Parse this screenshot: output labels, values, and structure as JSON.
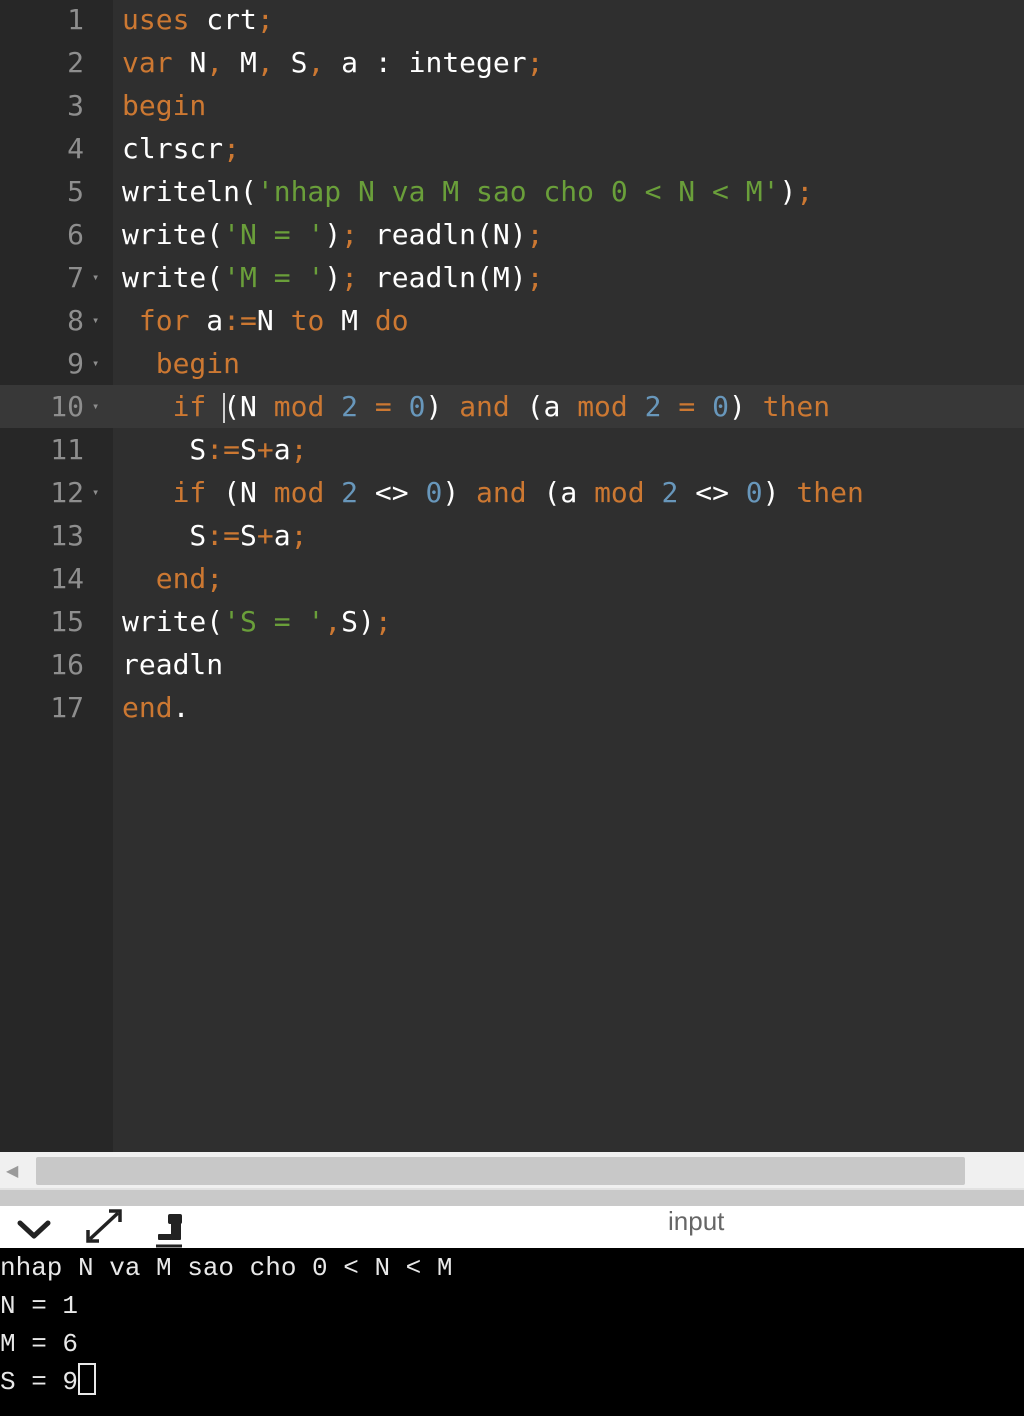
{
  "editor": {
    "lines": [
      {
        "num": "1",
        "fold": "",
        "tokens": [
          [
            "k",
            "uses "
          ],
          [
            "t",
            "crt"
          ],
          [
            "k",
            ";"
          ]
        ]
      },
      {
        "num": "2",
        "fold": "",
        "tokens": [
          [
            "k",
            "var "
          ],
          [
            "t",
            "N"
          ],
          [
            "k",
            ", "
          ],
          [
            "t",
            "M"
          ],
          [
            "k",
            ", "
          ],
          [
            "t",
            "S"
          ],
          [
            "k",
            ", "
          ],
          [
            "t",
            "a : integer"
          ],
          [
            "k",
            ";"
          ]
        ]
      },
      {
        "num": "3",
        "fold": "",
        "tokens": [
          [
            "k",
            "begin"
          ]
        ]
      },
      {
        "num": "4",
        "fold": "",
        "tokens": [
          [
            "t",
            "clrscr"
          ],
          [
            "k",
            ";"
          ]
        ]
      },
      {
        "num": "5",
        "fold": "",
        "tokens": [
          [
            "t",
            "writeln("
          ],
          [
            "s",
            "'nhap N va M sao cho 0 < N < M'"
          ],
          [
            "t",
            ")"
          ],
          [
            "k",
            ";"
          ]
        ]
      },
      {
        "num": "6",
        "fold": "",
        "tokens": [
          [
            "t",
            "write("
          ],
          [
            "s",
            "'N = '"
          ],
          [
            "t",
            ")"
          ],
          [
            "k",
            "; "
          ],
          [
            "t",
            "readln(N)"
          ],
          [
            "k",
            ";"
          ]
        ]
      },
      {
        "num": "7",
        "fold": "▾",
        "tokens": [
          [
            "t",
            "write("
          ],
          [
            "s",
            "'M = '"
          ],
          [
            "t",
            ")"
          ],
          [
            "k",
            "; "
          ],
          [
            "t",
            "readln(M)"
          ],
          [
            "k",
            ";"
          ]
        ]
      },
      {
        "num": "8",
        "fold": "▾",
        "tokens": [
          [
            "t",
            " "
          ],
          [
            "k",
            "for "
          ],
          [
            "t",
            "a"
          ],
          [
            "k",
            ":="
          ],
          [
            "t",
            "N "
          ],
          [
            "k",
            "to "
          ],
          [
            "t",
            "M "
          ],
          [
            "k",
            "do"
          ]
        ]
      },
      {
        "num": "9",
        "fold": "▾",
        "tokens": [
          [
            "t",
            "  "
          ],
          [
            "k",
            "begin"
          ]
        ]
      },
      {
        "num": "10",
        "fold": "▾",
        "active": true,
        "tokens": [
          [
            "t",
            "   "
          ],
          [
            "k",
            "if "
          ],
          [
            "caret",
            ""
          ],
          [
            "t",
            "(N "
          ],
          [
            "k",
            "mod "
          ],
          [
            "n",
            "2 "
          ],
          [
            "k",
            "= "
          ],
          [
            "n",
            "0"
          ],
          [
            "t",
            ") "
          ],
          [
            "k",
            "and "
          ],
          [
            "t",
            "(a "
          ],
          [
            "k",
            "mod "
          ],
          [
            "n",
            "2 "
          ],
          [
            "k",
            "= "
          ],
          [
            "n",
            "0"
          ],
          [
            "t",
            ") "
          ],
          [
            "k",
            "then"
          ]
        ]
      },
      {
        "num": "11",
        "fold": "",
        "tokens": [
          [
            "t",
            "    S"
          ],
          [
            "k",
            ":="
          ],
          [
            "t",
            "S"
          ],
          [
            "k",
            "+"
          ],
          [
            "t",
            "a"
          ],
          [
            "k",
            ";"
          ]
        ]
      },
      {
        "num": "12",
        "fold": "▾",
        "tokens": [
          [
            "t",
            "   "
          ],
          [
            "k",
            "if "
          ],
          [
            "t",
            "(N "
          ],
          [
            "k",
            "mod "
          ],
          [
            "n",
            "2 "
          ],
          [
            "t",
            "<> "
          ],
          [
            "n",
            "0"
          ],
          [
            "t",
            ") "
          ],
          [
            "k",
            "and "
          ],
          [
            "t",
            "(a "
          ],
          [
            "k",
            "mod "
          ],
          [
            "n",
            "2 "
          ],
          [
            "t",
            "<> "
          ],
          [
            "n",
            "0"
          ],
          [
            "t",
            ") "
          ],
          [
            "k",
            "then"
          ]
        ]
      },
      {
        "num": "13",
        "fold": "",
        "tokens": [
          [
            "t",
            "    S"
          ],
          [
            "k",
            ":="
          ],
          [
            "t",
            "S"
          ],
          [
            "k",
            "+"
          ],
          [
            "t",
            "a"
          ],
          [
            "k",
            ";"
          ]
        ]
      },
      {
        "num": "14",
        "fold": "",
        "tokens": [
          [
            "t",
            "  "
          ],
          [
            "k",
            "end;"
          ]
        ]
      },
      {
        "num": "15",
        "fold": "",
        "tokens": [
          [
            "t",
            "write("
          ],
          [
            "s",
            "'S = '"
          ],
          [
            "k",
            ","
          ],
          [
            "t",
            "S)"
          ],
          [
            "k",
            ";"
          ]
        ]
      },
      {
        "num": "16",
        "fold": "",
        "tokens": [
          [
            "t",
            "readln"
          ]
        ]
      },
      {
        "num": "17",
        "fold": "",
        "tokens": [
          [
            "k",
            "end"
          ],
          [
            "t",
            "."
          ]
        ]
      }
    ]
  },
  "console_bar": {
    "title": "input",
    "collapse_icon": "chevron-down-icon",
    "expand_icon": "expand-icon",
    "clear_icon": "clear-console-icon"
  },
  "console": {
    "lines": [
      "nhap N va M sao cho 0 < N < M",
      "N = 1",
      "M = 6",
      "S = 9"
    ]
  }
}
